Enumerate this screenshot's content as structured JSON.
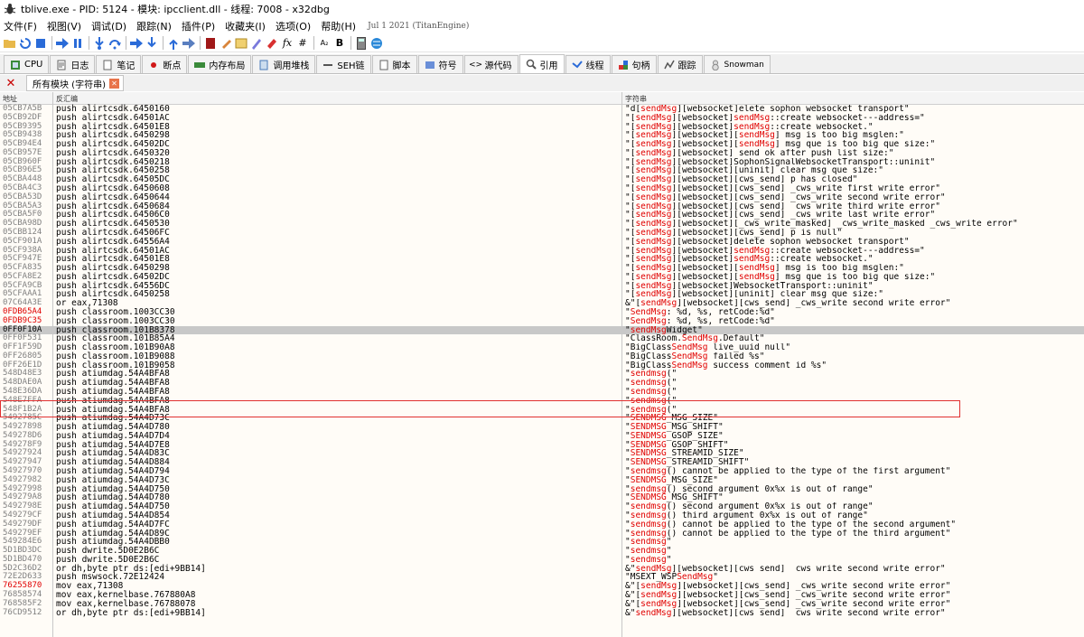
{
  "window": {
    "title": "tblive.exe - PID: 5124 - 模块: ipcclient.dll - 线程: 7008 - x32dbg"
  },
  "menu": {
    "items": [
      "文件(F)",
      "视图(V)",
      "调试(D)",
      "跟踪(N)",
      "插件(P)",
      "收藏夹(I)",
      "选项(O)",
      "帮助(H)"
    ],
    "build_date": "Jul 1 2021 (TitanEngine)"
  },
  "view_tabs": [
    {
      "label": "CPU",
      "icon": "cpu-icon"
    },
    {
      "label": "日志",
      "icon": "log-icon"
    },
    {
      "label": "笔记",
      "icon": "notes-icon"
    },
    {
      "label": "断点",
      "icon": "breakpoint-icon"
    },
    {
      "label": "内存布局",
      "icon": "memory-map-icon"
    },
    {
      "label": "调用堆栈",
      "icon": "call-stack-icon"
    },
    {
      "label": "SEH链",
      "icon": "seh-chain-icon"
    },
    {
      "label": "脚本",
      "icon": "script-icon"
    },
    {
      "label": "符号",
      "icon": "symbols-icon"
    },
    {
      "label": "源代码",
      "icon": "source-icon"
    },
    {
      "label": "引用",
      "icon": "references-icon"
    },
    {
      "label": "线程",
      "icon": "threads-icon"
    },
    {
      "label": "句柄",
      "icon": "handles-icon"
    },
    {
      "label": "跟踪",
      "icon": "trace-icon"
    },
    {
      "label": "Snowman",
      "icon": "snowman-icon"
    }
  ],
  "sub_tab": {
    "label": "所有模块 (字符串)"
  },
  "columns": {
    "address": "地址",
    "disassembly": "反汇编",
    "string": "字符串"
  },
  "colors": {
    "highlight": "#e00000",
    "selection": "#c8c8c8",
    "table_bg": "#fffcf7"
  },
  "rows": [
    {
      "addr": "05CB7A5B",
      "dis": "push alirtcsdk.6450160",
      "str": [
        "\"d[",
        "sendMsg",
        "][websocket]elete sophon websocket transport\""
      ]
    },
    {
      "addr": "05CB92DF",
      "dis": "push alirtcsdk.64501AC",
      "str": [
        "\"[",
        "sendMsg",
        "][websocket]",
        "sendMsg",
        "::create websocket---address=\""
      ]
    },
    {
      "addr": "05CB9395",
      "dis": "push alirtcsdk.64501E8",
      "str": [
        "\"[",
        "sendMsg",
        "][websocket]",
        "sendMsg",
        "::create websocket.\""
      ]
    },
    {
      "addr": "05CB9438",
      "dis": "push alirtcsdk.6450298",
      "str": [
        "\"[",
        "sendMsg",
        "][websocket][",
        "sendMsg",
        "] msg is too big msglen:\""
      ]
    },
    {
      "addr": "05CB94E4",
      "dis": "push alirtcsdk.64502DC",
      "str": [
        "\"[",
        "sendMsg",
        "][websocket][",
        "sendMsg",
        "] msg que is too big que size:\""
      ]
    },
    {
      "addr": "05CB957E",
      "dis": "push alirtcsdk.6450320",
      "str": [
        "\"[",
        "sendMsg",
        "][websocket] send ok after push list size:\""
      ]
    },
    {
      "addr": "05CB960F",
      "dis": "push alirtcsdk.6450218",
      "str": [
        "\"[",
        "sendMsg",
        "][websocket]SophonSignalWebsocketTransport::uninit\""
      ]
    },
    {
      "addr": "05CB96E5",
      "dis": "push alirtcsdk.6450258",
      "str": [
        "\"[",
        "sendMsg",
        "][websocket][uninit] clear msg que size:\""
      ]
    },
    {
      "addr": "05CBA448",
      "dis": "push alirtcsdk.64505DC",
      "str": [
        "\"[",
        "sendMsg",
        "][websocket][cws_send] p has closed\""
      ]
    },
    {
      "addr": "05CBA4C3",
      "dis": "push alirtcsdk.6450608",
      "str": [
        "\"[",
        "sendMsg",
        "][websocket][cws_send] _cws_write first write error\""
      ]
    },
    {
      "addr": "05CBA53D",
      "dis": "push alirtcsdk.6450644",
      "str": [
        "\"[",
        "sendMsg",
        "][websocket][cws_send] _cws_write second write error\""
      ]
    },
    {
      "addr": "05CBA5A3",
      "dis": "push alirtcsdk.6450684",
      "str": [
        "\"[",
        "sendMsg",
        "][websocket][cws_send] _cws_write third write error\""
      ]
    },
    {
      "addr": "05CBA5F0",
      "dis": "push alirtcsdk.64506C0",
      "str": [
        "\"[",
        "sendMsg",
        "][websocket][cws_send] _cws_write last write error\""
      ]
    },
    {
      "addr": "05CBA98D",
      "dis": "push alirtcsdk.6450530",
      "str": [
        "\"[",
        "sendMsg",
        "][websocket][_cws_write_masked] _cws_write_masked _cws_write error\""
      ]
    },
    {
      "addr": "05CBB124",
      "dis": "push alirtcsdk.64506FC",
      "str": [
        "\"[",
        "sendMsg",
        "][websocket][cws_send] p is null\""
      ]
    },
    {
      "addr": "05CF901A",
      "dis": "push alirtcsdk.64556A4",
      "str": [
        "\"[",
        "sendMsg",
        "][websocket]delete sophon websocket transport\""
      ]
    },
    {
      "addr": "05CF938A",
      "dis": "push alirtcsdk.64501AC",
      "str": [
        "\"[",
        "sendMsg",
        "][websocket]",
        "sendMsg",
        "::create websocket---address=\""
      ]
    },
    {
      "addr": "05CF947E",
      "dis": "push alirtcsdk.64501E8",
      "str": [
        "\"[",
        "sendMsg",
        "][websocket]",
        "sendMsg",
        "::create websocket.\""
      ]
    },
    {
      "addr": "05CFA835",
      "dis": "push alirtcsdk.6450298",
      "str": [
        "\"[",
        "sendMsg",
        "][websocket][",
        "sendMsg",
        "] msg is too big msglen:\""
      ]
    },
    {
      "addr": "05CFA8E2",
      "dis": "push alirtcsdk.64502DC",
      "str": [
        "\"[",
        "sendMsg",
        "][websocket][",
        "sendMsg",
        "] msg que is too big que size:\""
      ]
    },
    {
      "addr": "05CFA9CB",
      "dis": "push alirtcsdk.64556DC",
      "str": [
        "\"[",
        "sendMsg",
        "][websocket]WebsocketTransport::uninit\""
      ]
    },
    {
      "addr": "05CFAAA1",
      "dis": "push alirtcsdk.6450258",
      "str": [
        "\"[",
        "sendMsg",
        "][websocket][uninit] clear msg que size:\""
      ]
    },
    {
      "addr": "07C64A3E",
      "dis": "or eax,71308",
      "str": [
        "&\"[",
        "sendMsg",
        "][websocket][cws_send] _cws_write second write error\""
      ]
    },
    {
      "addr": "0FDB65A4",
      "dis": "push classroom.1003CC30",
      "str": [
        "\"",
        "SendMsg",
        ": %d, %s, retCode:%d\""
      ],
      "addr_red": true
    },
    {
      "addr": "0FDB9C35",
      "dis": "push classroom.1003CC30",
      "str": [
        "\"",
        "SendMsg",
        ": %d, %s, retCode:%d\""
      ],
      "addr_red": true
    },
    {
      "addr": "0FF0F10A",
      "dis": "push classroom.101B8378",
      "str": [
        "\"",
        "sendMsg",
        "Widget\""
      ],
      "selected": true
    },
    {
      "addr": "0FF0F531",
      "dis": "push classroom.101B85A4",
      "str": [
        "\"ClassRoom.",
        "SendMsg",
        ".Default\""
      ]
    },
    {
      "addr": "0FF1F59D",
      "dis": "push classroom.101B90A8",
      "str": [
        "\"BigClass",
        "SendMsg",
        " live_uuid null\""
      ]
    },
    {
      "addr": "0FF26805",
      "dis": "push classroom.101B9088",
      "str": [
        "\"BigClass",
        "SendMsg",
        " failed %s\""
      ]
    },
    {
      "addr": "0FF26E1D",
      "dis": "push classroom.101B9058",
      "str": [
        "\"BigClass",
        "SendMsg",
        " success comment id %s\""
      ]
    },
    {
      "addr": "548D48E3",
      "dis": "push atiumdag.54A4BFA8",
      "str": [
        "\"",
        "sendmsg",
        "(\""
      ]
    },
    {
      "addr": "548DAE0A",
      "dis": "push atiumdag.54A4BFA8",
      "str": [
        "\"",
        "sendmsg",
        "(\""
      ]
    },
    {
      "addr": "548E36DA",
      "dis": "push atiumdag.54A4BFA8",
      "str": [
        "\"",
        "sendmsg",
        "(\""
      ]
    },
    {
      "addr": "548E7FFA",
      "dis": "push atiumdag.54A4BFA8",
      "str": [
        "\"",
        "sendmsg",
        "(\""
      ]
    },
    {
      "addr": "548F1B2A",
      "dis": "push atiumdag.54A4BFA8",
      "str": [
        "\"",
        "sendmsg",
        "(\""
      ]
    },
    {
      "addr": "5492785C",
      "dis": "push atiumdag.54A4D73C",
      "str": [
        "\"",
        "SENDMSG",
        "_MSG_SIZE\""
      ]
    },
    {
      "addr": "54927898",
      "dis": "push atiumdag.54A4D780",
      "str": [
        "\"",
        "SENDMSG",
        "_MSG_SHIFT\""
      ]
    },
    {
      "addr": "549278D6",
      "dis": "push atiumdag.54A4D7D4",
      "str": [
        "\"",
        "SENDMSG",
        "_GSOP_SIZE\""
      ]
    },
    {
      "addr": "549278F9",
      "dis": "push atiumdag.54A4D7E8",
      "str": [
        "\"",
        "SENDMSG",
        "_GSOP_SHIFT\""
      ]
    },
    {
      "addr": "54927924",
      "dis": "push atiumdag.54A4D83C",
      "str": [
        "\"",
        "SENDMSG",
        "_STREAMID_SIZE\""
      ]
    },
    {
      "addr": "54927947",
      "dis": "push atiumdag.54A4D884",
      "str": [
        "\"",
        "SENDMSG",
        "_STREAMID_SHIFT\""
      ]
    },
    {
      "addr": "54927970",
      "dis": "push atiumdag.54A4D794",
      "str": [
        "\"",
        "sendmsg",
        "() cannot be applied to the type of the first argument\""
      ]
    },
    {
      "addr": "54927982",
      "dis": "push atiumdag.54A4D73C",
      "str": [
        "\"",
        "SENDMSG",
        "_MSG_SIZE\""
      ]
    },
    {
      "addr": "54927998",
      "dis": "push atiumdag.54A4D750",
      "str": [
        "\"",
        "sendmsg",
        "() second argument 0x%x is out of range\""
      ]
    },
    {
      "addr": "549279A8",
      "dis": "push atiumdag.54A4D780",
      "str": [
        "\"",
        "SENDMSG",
        "_MSG_SHIFT\""
      ]
    },
    {
      "addr": "5492798E",
      "dis": "push atiumdag.54A4D750",
      "str": [
        "\"",
        "sendmsg",
        "() second argument 0x%x is out of range\""
      ]
    },
    {
      "addr": "549279CF",
      "dis": "push atiumdag.54A4D854",
      "str": [
        "\"",
        "sendmsg",
        "() third argument 0x%x is out of range\""
      ]
    },
    {
      "addr": "549279DF",
      "dis": "push atiumdag.54A4D7FC",
      "str": [
        "\"",
        "sendmsg",
        "() cannot be applied to the type of the second argument\""
      ]
    },
    {
      "addr": "549279EF",
      "dis": "push atiumdag.54A4D89C",
      "str": [
        "\"",
        "sendmsg",
        "() cannot be applied to the type of the third argument\""
      ]
    },
    {
      "addr": "549284E6",
      "dis": "push atiumdag.54A4DBB0",
      "str": [
        "\"",
        "sendmsg",
        "\""
      ]
    },
    {
      "addr": "5D1BD3DC",
      "dis": "push dwrite.5D0E2B6C",
      "str": [
        "\"",
        "sendmsg",
        "\""
      ]
    },
    {
      "addr": "5D1BD470",
      "dis": "push dwrite.5D0E2B6C",
      "str": [
        "\"",
        "sendmsg",
        "\""
      ]
    },
    {
      "addr": "5D2C36D2",
      "dis": "or dh,byte ptr ds:[edi+9BB14]",
      "str": [
        "&\"",
        "sendMsg",
        "][websocket][cws_send] _cws_write second write error\""
      ]
    },
    {
      "addr": "72E2D633",
      "dis": "push mswsock.72E12424",
      "str": [
        "\"MSEXT_WSP",
        "SendMsg",
        "\""
      ]
    },
    {
      "addr": "76255870",
      "dis": "mov eax,71308",
      "str": [
        "&\"[",
        "sendMsg",
        "][websocket][cws_send] _cws_write second write error\""
      ],
      "addr_red": true
    },
    {
      "addr": "76858574",
      "dis": "mov eax,kernelbase.767880A8",
      "str": [
        "&\"[",
        "sendMsg",
        "][websocket][cws_send] _cws_write second write error\""
      ]
    },
    {
      "addr": "768585F2",
      "dis": "mov eax,kernelbase.76788078",
      "str": [
        "&\"[",
        "sendMsg",
        "][websocket][cws_send] _cws_write second write error\""
      ]
    },
    {
      "addr": "76CD9512",
      "dis": "or dh,byte ptr ds:[edi+9BB14]",
      "str": [
        "&\"",
        "sendMsg",
        "][websocket][cws_send] _cws_write second write error\""
      ]
    }
  ]
}
